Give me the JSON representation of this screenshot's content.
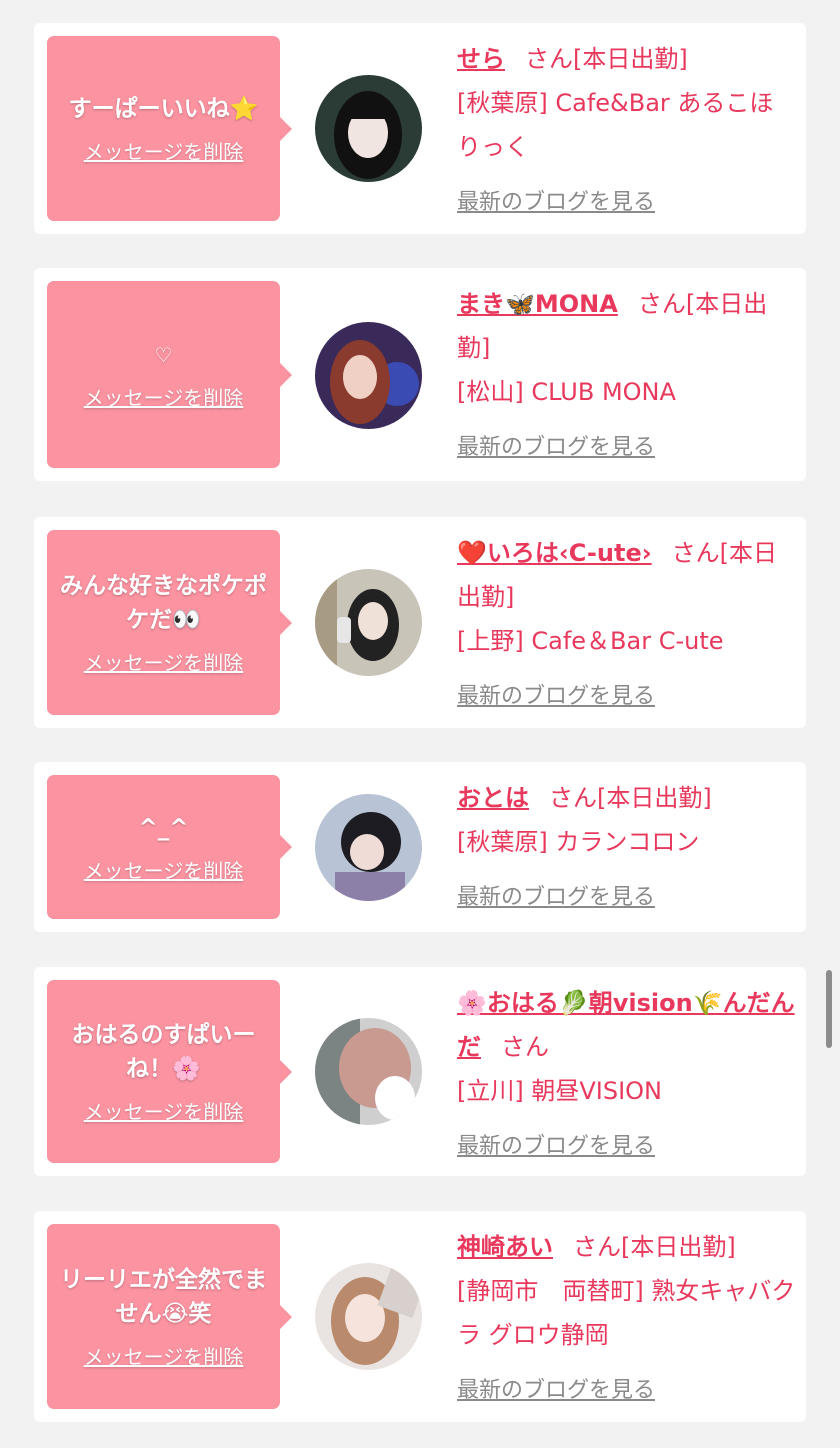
{
  "items": [
    {
      "message": "すーぱーいいね⭐",
      "delete_label": "メッセージを削除",
      "name": "せら",
      "san_label": "さん[本日出勤]",
      "shop": "[秋葉原] Cafe&Bar あるこほりっく",
      "blog_label": "最新のブログを見る"
    },
    {
      "message": "♡",
      "delete_label": "メッセージを削除",
      "name": "まき🦋MONA",
      "san_label": "さん[本日出勤]",
      "shop": "[松山] CLUB MONA",
      "blog_label": "最新のブログを見る"
    },
    {
      "message": "みんな好きなポケポケだ👀",
      "delete_label": "メッセージを削除",
      "name": "❤️いろは‹C-ute›",
      "san_label": "さん[本日出勤]",
      "shop": "[上野] Cafe＆Bar C-ute",
      "blog_label": "最新のブログを見る"
    },
    {
      "message": "^_^",
      "delete_label": "メッセージを削除",
      "name": "おとは",
      "san_label": "さん[本日出勤]",
      "shop": "[秋葉原] カランコロン",
      "blog_label": "最新のブログを見る"
    },
    {
      "message": "おはるのすぱいーね！🌸",
      "delete_label": "メッセージを削除",
      "name": "🌸おはる🥬朝vision🌾んだんだ",
      "san_label": "さん",
      "shop": "[立川] 朝昼VISION",
      "blog_label": "最新のブログを見る"
    },
    {
      "message": "リーリエが全然でません😭笑",
      "delete_label": "メッセージを削除",
      "name": "神崎あい",
      "san_label": "さん[本日出勤]",
      "shop": "[静岡市　両替町] 熟女キャバクラ グロウ静岡",
      "blog_label": "最新のブログを見る"
    }
  ],
  "colors": {
    "background": "#f2f2f2",
    "card": "#ffffff",
    "bubble": "#fb93a1",
    "accent_text": "#e8395d",
    "link_gray": "#8a8a8a"
  }
}
